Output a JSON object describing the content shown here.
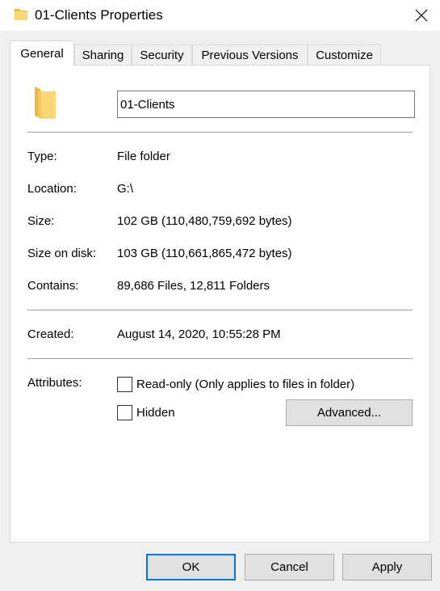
{
  "window": {
    "title": "01-Clients Properties",
    "icon": "folder-icon",
    "close_icon": "close-icon"
  },
  "tabs": [
    {
      "label": "General",
      "active": true
    },
    {
      "label": "Sharing",
      "active": false
    },
    {
      "label": "Security",
      "active": false
    },
    {
      "label": "Previous Versions",
      "active": false
    },
    {
      "label": "Customize",
      "active": false
    }
  ],
  "general": {
    "name_value": "01-Clients",
    "type_label": "Type:",
    "type_value": "File folder",
    "location_label": "Location:",
    "location_value": "G:\\",
    "size_label": "Size:",
    "size_value": "102 GB (110,480,759,692 bytes)",
    "size_on_disk_label": "Size on disk:",
    "size_on_disk_value": "103 GB (110,661,865,472 bytes)",
    "contains_label": "Contains:",
    "contains_value": "89,686 Files, 12,811 Folders",
    "created_label": "Created:",
    "created_value": "August 14, 2020, 10:55:28 PM",
    "attributes_label": "Attributes:",
    "readonly_label": "Read-only (Only applies to files in folder)",
    "readonly_checked": false,
    "hidden_label": "Hidden",
    "hidden_checked": false,
    "advanced_label": "Advanced..."
  },
  "buttons": {
    "ok": "OK",
    "cancel": "Cancel",
    "apply": "Apply"
  },
  "colors": {
    "folder_yellow": "#f8d775",
    "folder_dark": "#e8b94a",
    "accent_focus": "#0078d7"
  }
}
